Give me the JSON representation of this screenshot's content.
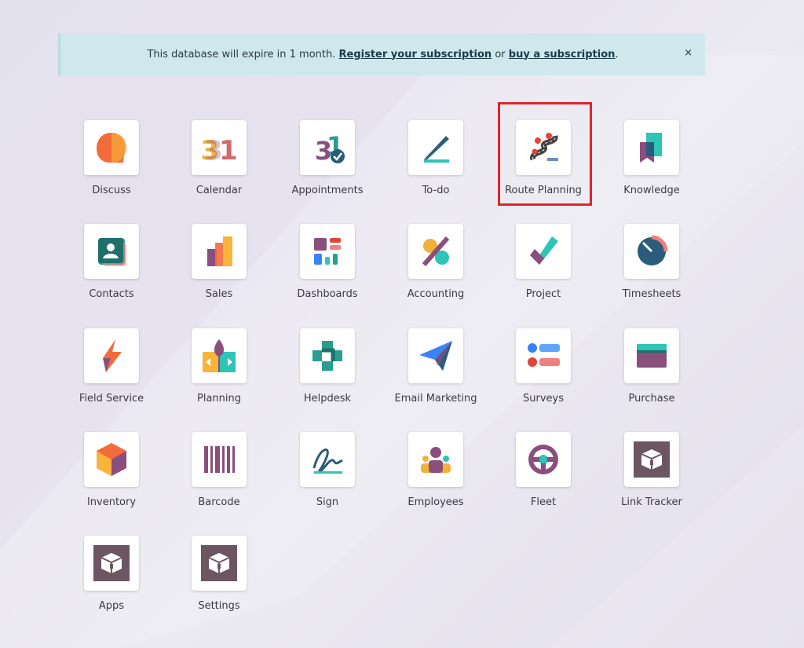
{
  "banner": {
    "text_before": "This database will expire in 1 month.",
    "link_register": "Register your subscription",
    "text_or": "or",
    "link_buy": "buy a subscription",
    "text_after": ".",
    "close": "×"
  },
  "apps": [
    {
      "label": "Discuss",
      "icon": "discuss-icon"
    },
    {
      "label": "Calendar",
      "icon": "calendar-icon"
    },
    {
      "label": "Appointments",
      "icon": "appointments-icon"
    },
    {
      "label": "To-do",
      "icon": "todo-icon"
    },
    {
      "label": "Route Planning",
      "icon": "route-planning-icon"
    },
    {
      "label": "Knowledge",
      "icon": "knowledge-icon"
    },
    {
      "label": "Contacts",
      "icon": "contacts-icon"
    },
    {
      "label": "Sales",
      "icon": "sales-icon"
    },
    {
      "label": "Dashboards",
      "icon": "dashboards-icon"
    },
    {
      "label": "Accounting",
      "icon": "accounting-icon"
    },
    {
      "label": "Project",
      "icon": "project-icon"
    },
    {
      "label": "Timesheets",
      "icon": "timesheets-icon"
    },
    {
      "label": "Field Service",
      "icon": "field-service-icon"
    },
    {
      "label": "Planning",
      "icon": "planning-icon"
    },
    {
      "label": "Helpdesk",
      "icon": "helpdesk-icon"
    },
    {
      "label": "Email Marketing",
      "icon": "email-marketing-icon"
    },
    {
      "label": "Surveys",
      "icon": "surveys-icon"
    },
    {
      "label": "Purchase",
      "icon": "purchase-icon"
    },
    {
      "label": "Inventory",
      "icon": "inventory-icon"
    },
    {
      "label": "Barcode",
      "icon": "barcode-icon"
    },
    {
      "label": "Sign",
      "icon": "sign-icon"
    },
    {
      "label": "Employees",
      "icon": "employees-icon"
    },
    {
      "label": "Fleet",
      "icon": "fleet-icon"
    },
    {
      "label": "Link Tracker",
      "icon": "link-tracker-icon"
    },
    {
      "label": "Apps",
      "icon": "apps-icon"
    },
    {
      "label": "Settings",
      "icon": "settings-icon"
    }
  ],
  "calendar_number": "31",
  "colors": {
    "highlight": "#e0242b",
    "banner_bg": "#cfe8ee"
  }
}
